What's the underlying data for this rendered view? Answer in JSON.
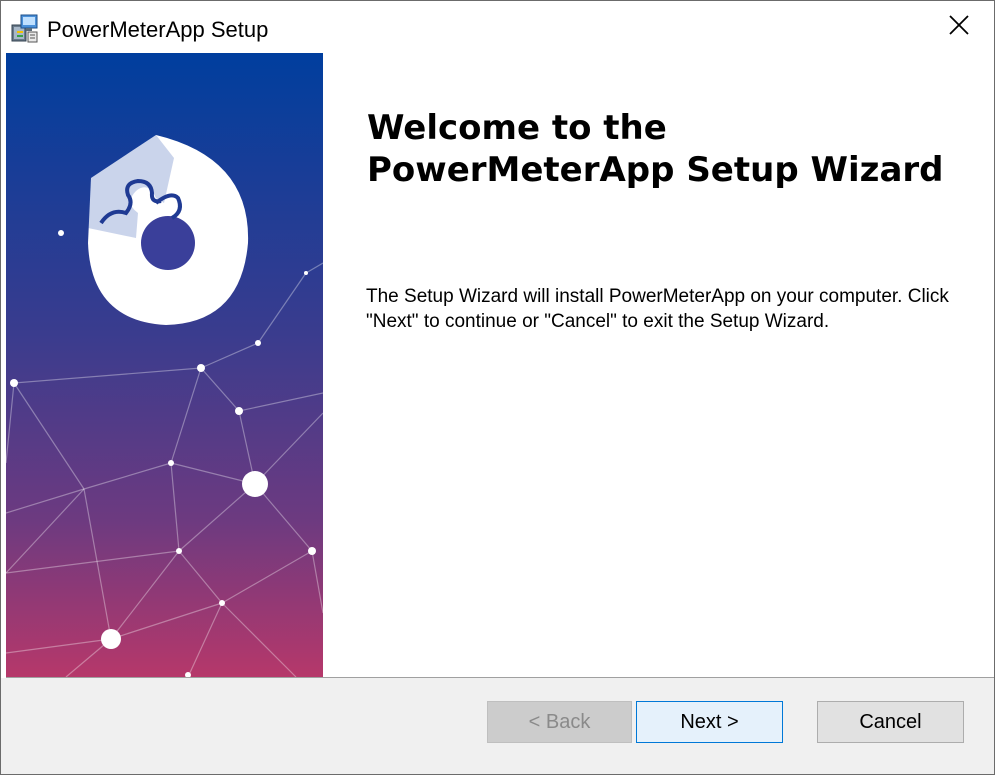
{
  "window": {
    "title": "PowerMeterApp Setup",
    "app_icon": "installer-package-icon",
    "close_icon": "close-icon"
  },
  "content": {
    "heading_line1": "Welcome to the",
    "heading_line2": "PowerMeterApp Setup Wizard",
    "body": "The Setup Wizard will install PowerMeterApp on your computer.  Click \"Next\" to continue or \"Cancel\" to exit the Setup Wizard."
  },
  "buttons": {
    "back": "< Back",
    "next": "Next >",
    "cancel": "Cancel"
  },
  "colors": {
    "banner_top": "#003a9c",
    "banner_mid": "#3e3c8c",
    "banner_bottom": "#b0396a",
    "next_border": "#0078d7",
    "next_bg": "#e5f1fb",
    "footer_bg": "#f0f0f0"
  }
}
